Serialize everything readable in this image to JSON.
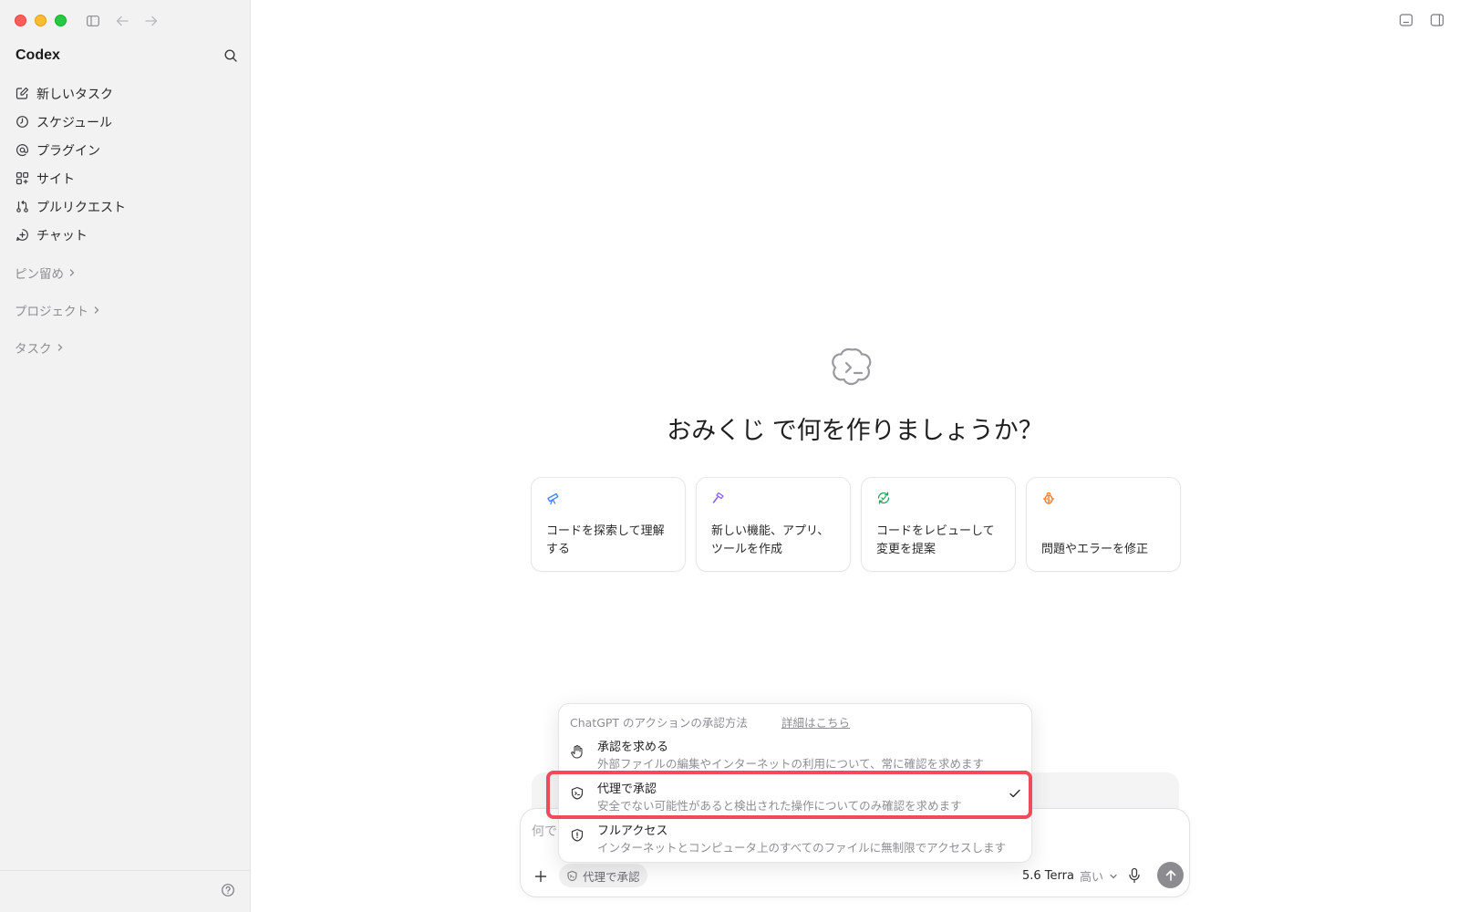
{
  "sidebar": {
    "brand": "Codex",
    "nav": [
      {
        "label": "新しいタスク",
        "icon": "edit-icon"
      },
      {
        "label": "スケジュール",
        "icon": "clock-icon"
      },
      {
        "label": "プラグイン",
        "icon": "at-icon"
      },
      {
        "label": "サイト",
        "icon": "apps-icon"
      },
      {
        "label": "プルリクエスト",
        "icon": "pull-request-icon"
      },
      {
        "label": "チャット",
        "icon": "chat-plus-icon"
      }
    ],
    "sections": [
      "ピン留め",
      "プロジェクト",
      "タスク"
    ]
  },
  "main": {
    "project_name": "おみくじ",
    "headline_rest": " で何を作りましょうか？",
    "cards": [
      {
        "label": "コードを探索して理解する",
        "icon": "telescope-icon",
        "color": "#3b82f6"
      },
      {
        "label": "新しい機能、アプリ、ツールを作成",
        "icon": "hammer-icon",
        "color": "#8b5cf6"
      },
      {
        "label": "コードをレビューして変更を提案",
        "icon": "review-icon",
        "color": "#22a559"
      },
      {
        "label": "問題やエラーを修正",
        "icon": "bug-icon",
        "color": "#f97316"
      }
    ]
  },
  "menu": {
    "header": "ChatGPT のアクションの承認方法",
    "link": "詳細はこちら",
    "options": [
      {
        "title": "承認を求める",
        "desc": "外部ファイルの編集やインターネットの利用について、常に確認を求めます",
        "icon": "hand-icon"
      },
      {
        "title": "代理で承認",
        "desc": "安全でない可能性があると検出された操作についてのみ確認を求めます",
        "icon": "shield-terminal-icon",
        "selected": true
      },
      {
        "title": "フルアクセス",
        "desc": "インターネットとコンピュータ上のすべてのファイルに無制限でアクセスします",
        "icon": "shield-alert-icon"
      }
    ]
  },
  "composer": {
    "placeholder": "何で",
    "permission_label": "代理で承認",
    "model": "5.6 Terra",
    "level": "高い"
  }
}
